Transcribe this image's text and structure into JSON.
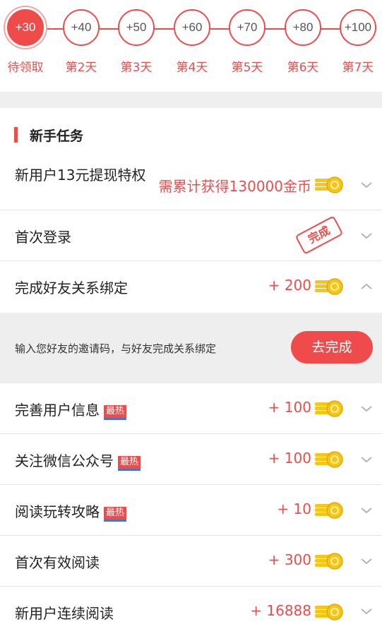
{
  "checkin": {
    "days": [
      {
        "bonus": "+30",
        "label": "待领取",
        "active": true
      },
      {
        "bonus": "+40",
        "label": "第2天",
        "active": false
      },
      {
        "bonus": "+50",
        "label": "第3天",
        "active": false
      },
      {
        "bonus": "+60",
        "label": "第4天",
        "active": false
      },
      {
        "bonus": "+70",
        "label": "第5天",
        "active": false
      },
      {
        "bonus": "+80",
        "label": "第6天",
        "active": false
      },
      {
        "bonus": "+100",
        "label": "第7天",
        "active": false
      }
    ]
  },
  "section": {
    "title": "新手任务"
  },
  "tasks": [
    {
      "name": "新用户13元提现特权",
      "reward": "需累计获得130000金币",
      "state": "collapsed"
    },
    {
      "name": "首次登录",
      "stamp": "完成",
      "state": "collapsed"
    },
    {
      "name": "完成好友关系绑定",
      "reward": "+ 200",
      "state": "expanded"
    },
    {
      "name": "完善用户信息",
      "badge": "最热",
      "reward": "+ 100",
      "state": "collapsed"
    },
    {
      "name": "关注微信公众号",
      "badge": "最热",
      "reward": "+ 100",
      "state": "collapsed"
    },
    {
      "name": "阅读玩转攻略",
      "badge": "最热",
      "reward": "+ 10",
      "state": "collapsed"
    },
    {
      "name": "首次有效阅读",
      "reward": "+ 300",
      "state": "collapsed"
    },
    {
      "name": "新用户连续阅读",
      "reward": "+ 16888",
      "state": "collapsed"
    }
  ],
  "expanded_task": {
    "description": "输入您好友的邀请码，与好友完成关系绑定",
    "button_label": "去完成"
  },
  "icons": {
    "coin": "coin-stack-icon",
    "expand": "chevron-down-icon",
    "collapse": "chevron-up-icon"
  },
  "colors": {
    "accent": "#f04b4b",
    "coin": "#f5c518",
    "hot_underline": "#4a74c9"
  }
}
